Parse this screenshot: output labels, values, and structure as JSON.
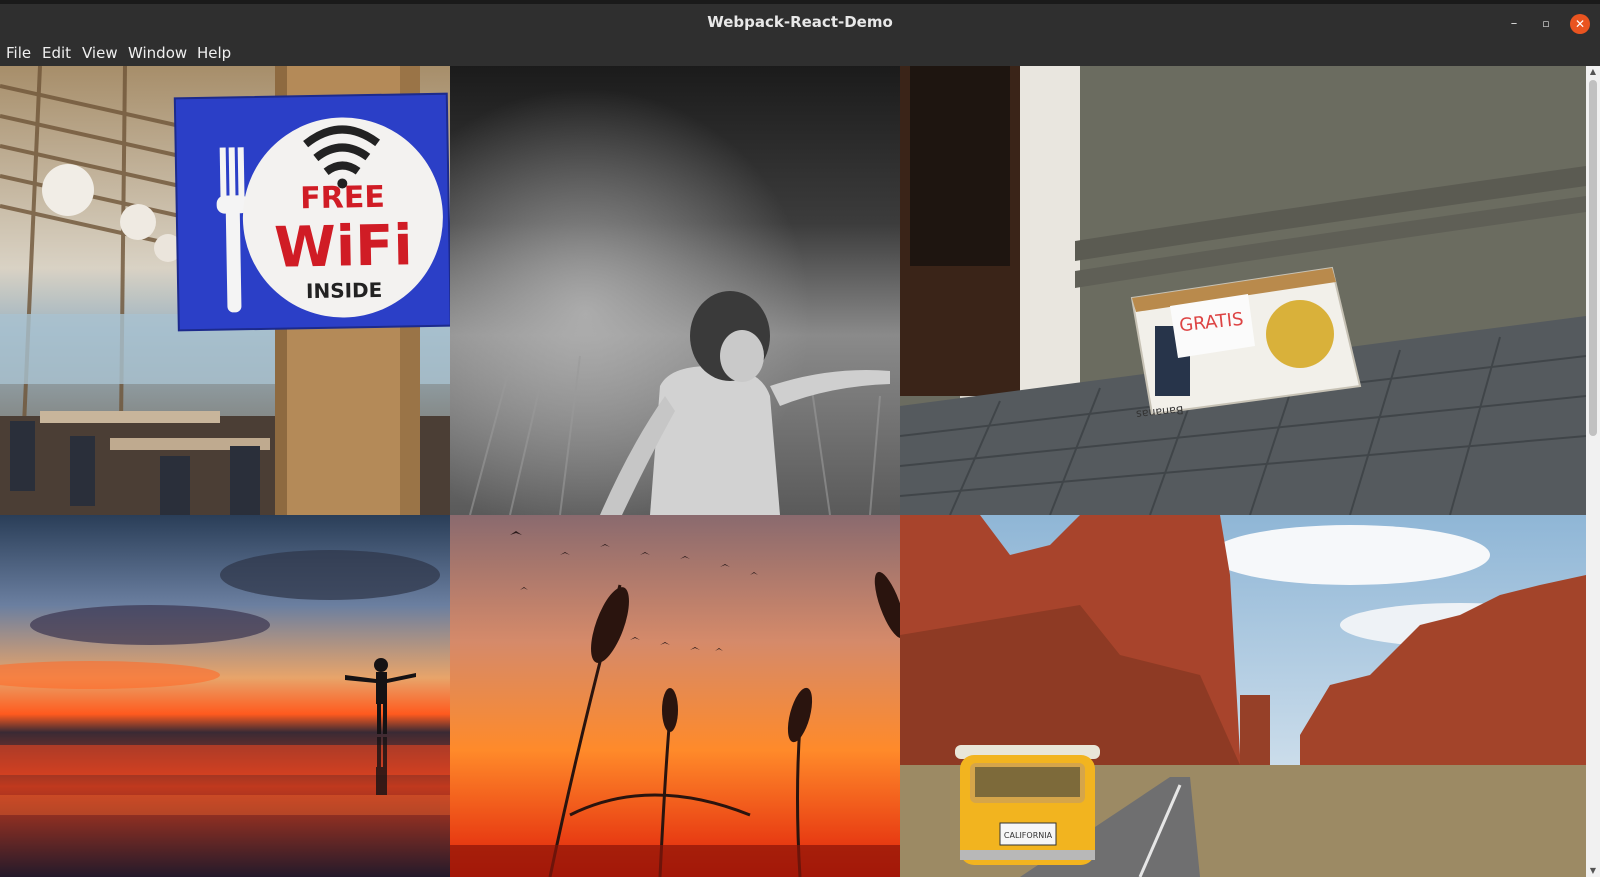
{
  "window": {
    "title": "Webpack-React-Demo",
    "controls": {
      "minimize": "–",
      "maximize": "▫",
      "close": "✕"
    }
  },
  "menu": {
    "items": [
      {
        "label": "File"
      },
      {
        "label": "Edit"
      },
      {
        "label": "View"
      },
      {
        "label": "Window"
      },
      {
        "label": "Help"
      }
    ]
  },
  "gallery": {
    "photos": [
      {
        "subject": "free-wifi-sign",
        "sign_lines": [
          "FREE",
          "WiFi",
          "INSIDE"
        ]
      },
      {
        "subject": "child-in-field-bw"
      },
      {
        "subject": "gratis-box",
        "note": "GRATIS",
        "box_text": "Bananas"
      },
      {
        "subject": "sunset-silhouette"
      },
      {
        "subject": "reeds-at-sunset"
      },
      {
        "subject": "desert-road-van",
        "plate": "CALIFORNIA"
      }
    ]
  },
  "colors": {
    "titlebar": "#2f2f2f",
    "close_button": "#e95420",
    "sign_blue": "#2b3fc7",
    "sign_red": "#d01c25"
  }
}
